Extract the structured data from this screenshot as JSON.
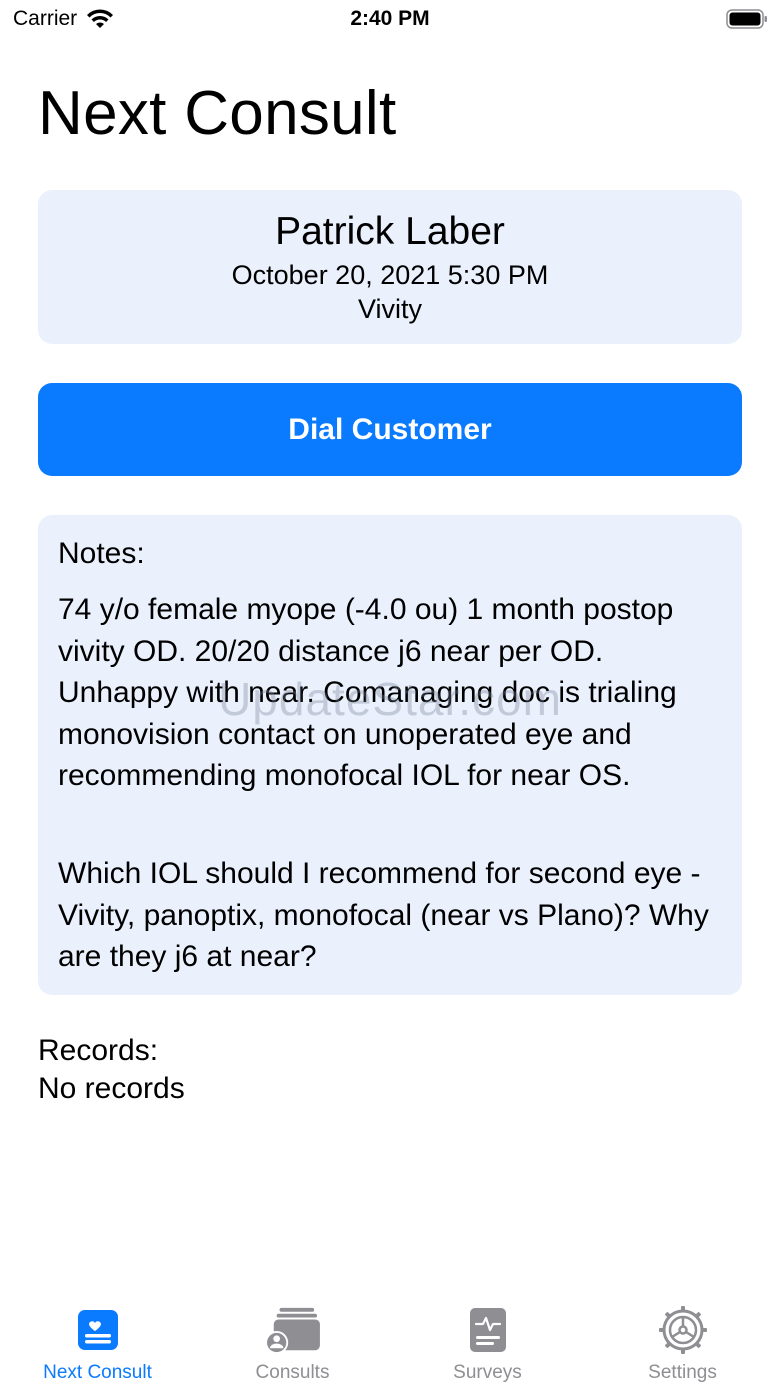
{
  "status_bar": {
    "carrier": "Carrier",
    "time": "2:40 PM"
  },
  "page": {
    "title": "Next Consult"
  },
  "consult": {
    "patient_name": "Patrick Laber",
    "datetime": "October 20, 2021 5:30 PM",
    "product": "Vivity"
  },
  "actions": {
    "dial_label": "Dial Customer"
  },
  "notes": {
    "heading": "Notes:",
    "body": "74 y/o female myope (-4.0 ou) 1 month postop vivity OD.  20/20 distance j6 near per OD.  Unhappy with near.  Comanaging doc is trialing monovision contact on unoperated eye and recommending monofocal IOL for near OS.",
    "question": "Which IOL should I recommend for second eye - Vivity, panoptix, monofocal (near vs Plano)?  Why are they j6 at near?"
  },
  "records": {
    "heading": "Records:",
    "empty_text": "No records"
  },
  "watermark": "UpdateStar.com",
  "tab_bar": {
    "items": [
      {
        "label": "Next Consult",
        "icon": "consult-card-icon",
        "active": true
      },
      {
        "label": "Consults",
        "icon": "consults-stack-icon",
        "active": false
      },
      {
        "label": "Surveys",
        "icon": "survey-document-icon",
        "active": false
      },
      {
        "label": "Settings",
        "icon": "gear-icon",
        "active": false
      }
    ]
  },
  "colors": {
    "accent": "#0a7aff",
    "card_background": "#eaf1fd",
    "inactive_tab": "#8e8e93"
  }
}
